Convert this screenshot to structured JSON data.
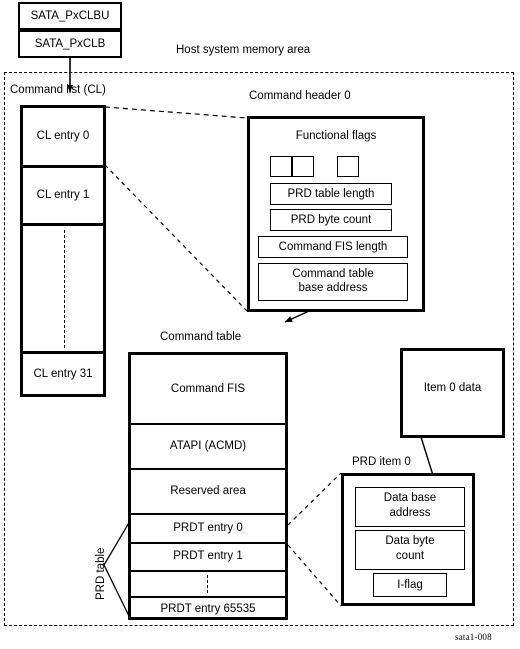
{
  "figure": {
    "id_label": "sata1-008",
    "host_area_label": "Host system memory area"
  },
  "registers": [
    {
      "name": "SATA_PxCLBU"
    },
    {
      "name": "SATA_PxCLB"
    }
  ],
  "command_list": {
    "title": "Command list (CL)",
    "entries": [
      "CL entry 0",
      "CL entry 1",
      "",
      "CL entry 31"
    ]
  },
  "command_header": {
    "title": "Command header 0",
    "flags_label": "Functional flags",
    "flag_boxes": 3,
    "fields": [
      "PRD table length",
      "PRD byte count",
      "Command FIS  length",
      "Command table\nbase  address"
    ],
    "field_lines": {
      "prd_table_length": "PRD table length",
      "prd_byte_count": "PRD byte count",
      "command_fis_length": "Command FIS  length",
      "command_table_base_address_line1": "Command table",
      "command_table_base_address_line2": "base  address"
    }
  },
  "command_table": {
    "title": "Command table",
    "prd_table_label": "PRD table",
    "rows": [
      "Command FIS",
      "ATAPI (ACMD)",
      "Reserved area",
      "PRDT entry 0",
      "PRDT entry 1",
      "",
      "PRDT entry 65535"
    ]
  },
  "prd_item": {
    "title": "PRD item 0",
    "fields": {
      "data_base_address_line1": "Data base",
      "data_base_address_line2": "address",
      "data_byte_count_line1": "Data byte",
      "data_byte_count_line2": "count",
      "i_flag": "I-flag"
    }
  },
  "item_data": {
    "label": "Item 0 data"
  },
  "colors": {
    "stroke": "#000000",
    "background": "#ffffff"
  }
}
